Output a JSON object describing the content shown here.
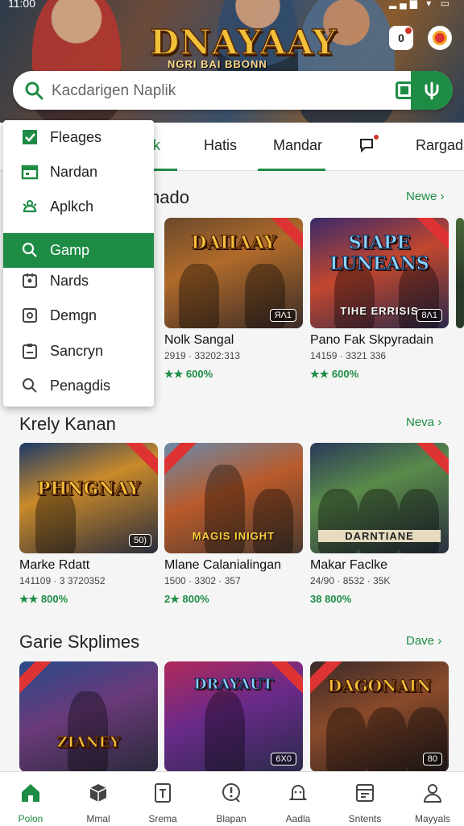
{
  "status": {
    "time": "11:00",
    "icons": "▂▄▆ ▾ ▭"
  },
  "hero": {
    "title": "DNAYAAY",
    "subtitle": "NGRI BAI BBONN"
  },
  "search": {
    "placeholder": "Kacdarigen Naplik"
  },
  "tabs": [
    {
      "label": "k"
    },
    {
      "label": "Hatis"
    },
    {
      "label": "Mandar"
    },
    {
      "label": ""
    },
    {
      "label": "Rargada"
    }
  ],
  "menu": [
    {
      "label": "Fleages",
      "icon": "checkbox-icon"
    },
    {
      "label": "Nardan",
      "icon": "calendar-icon"
    },
    {
      "label": "Aplkch",
      "icon": "android-icon"
    },
    {
      "label": "Gamp",
      "icon": "search-icon"
    },
    {
      "label": "Nards",
      "icon": "badge-icon"
    },
    {
      "label": "Demgn",
      "icon": "square-icon"
    },
    {
      "label": "Sancryn",
      "icon": "clipboard-icon"
    },
    {
      "label": "Penagdis",
      "icon": "search-icon"
    }
  ],
  "sections": [
    {
      "title": "nado",
      "more": "Newe",
      "cards": [
        {
          "name": "Nolk Sangal",
          "meta": "2919 · 33202:313",
          "rating": "★★ 600%",
          "logo": "DAIIAAY",
          "caption": "",
          "badge": "ЯΛ1"
        },
        {
          "name": "Pano Fak Skpyradain",
          "meta": "14159 · 3321 336",
          "rating": "★★ 600%",
          "logo": "SIAPE LUNEANS",
          "caption": "TIHE ERRISIS",
          "badge": "8Λ1"
        }
      ]
    },
    {
      "title": "Krely Kanan",
      "more": "Neva",
      "cards": [
        {
          "name": "Marke Rdatt",
          "meta": "141109 · 3 3720352",
          "rating": "★★ 800%",
          "logo": "PHNGNAY",
          "caption": "",
          "badge": "50)"
        },
        {
          "name": "Mlane Calanialingan",
          "meta": "1500 · 3302 · 357",
          "rating": "2★ 800%",
          "logo": "",
          "caption": "MAGIS INIGHT",
          "badge": ""
        },
        {
          "name": "Makar Faclke",
          "meta": "24/90 · 8532 · 35K",
          "rating": "38 800%",
          "logo": "",
          "caption": "DARNTIANE",
          "badge": ""
        }
      ]
    },
    {
      "title": "Garie Skplimes",
      "more": "Dave",
      "cards": [
        {
          "name": "",
          "meta": "",
          "rating": "",
          "logo": "ZIANEY",
          "caption": "",
          "badge": ""
        },
        {
          "name": "",
          "meta": "",
          "rating": "",
          "logo": "DRAYAUT",
          "caption": "",
          "badge": "6X0"
        },
        {
          "name": "",
          "meta": "",
          "rating": "",
          "logo": "DAGONAIN",
          "caption": "",
          "badge": "80"
        }
      ]
    }
  ],
  "bottom_nav": [
    {
      "label": "Polon",
      "icon": "home-icon"
    },
    {
      "label": "Mmal",
      "icon": "cube-icon"
    },
    {
      "label": "Srema",
      "icon": "document-icon"
    },
    {
      "label": "Blapan",
      "icon": "alert-icon"
    },
    {
      "label": "Aadla",
      "icon": "bell-icon"
    },
    {
      "label": "Sntents",
      "icon": "calendar-icon"
    },
    {
      "label": "Mayyals",
      "icon": "person-icon"
    }
  ],
  "colors": {
    "accent": "#1e8c45"
  }
}
